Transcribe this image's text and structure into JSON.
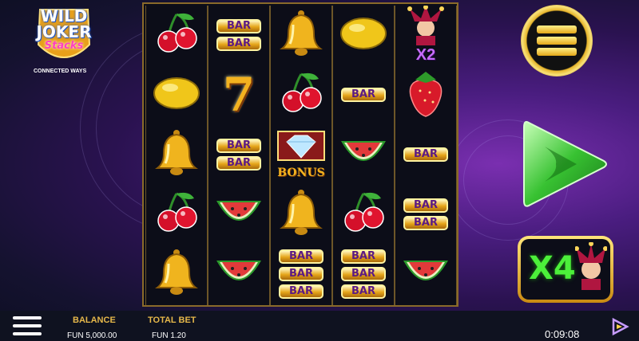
{
  "logo": {
    "line1": "WILD",
    "line2": "JOKER",
    "line3": "Stacks",
    "provider_text": "CONNECTED WAYS"
  },
  "reels": [
    [
      "cherry",
      "lemon",
      "bell",
      "cherry",
      "bell"
    ],
    [
      "double-bar",
      "seven",
      "double-bar",
      "watermelon",
      "watermelon"
    ],
    [
      "bell",
      "cherry",
      "bonus",
      "bell",
      "triple-bar"
    ],
    [
      "lemon",
      "single-bar",
      "watermelon",
      "cherry",
      "triple-bar"
    ],
    [
      "joker",
      "strawberry",
      "single-bar",
      "double-bar",
      "watermelon"
    ]
  ],
  "symbols": {
    "bar_text": "BAR",
    "bonus_text": "BONUS",
    "seven_text": "7",
    "joker_multiplier": "X2"
  },
  "multiplier_badge": {
    "value": "X4"
  },
  "bottom_bar": {
    "balance_label": "BALANCE",
    "balance_value": "FUN 5,000.00",
    "total_bet_label": "TOTAL BET",
    "total_bet_value": "FUN 1.20",
    "clock": "0:09:08"
  },
  "colors": {
    "gold": "#e6b84a",
    "green": "#4cf03a",
    "purple": "#4a1d80"
  }
}
